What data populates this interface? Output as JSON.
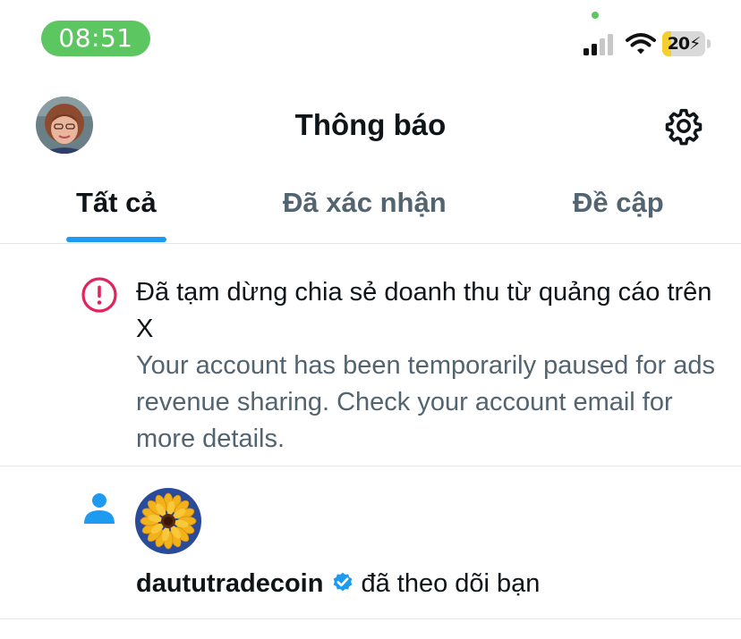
{
  "status_bar": {
    "time": "08:51",
    "battery": "20",
    "battery_level": 0.2,
    "charging": true,
    "signal_icon": "cellular-signal-icon",
    "wifi_icon": "wifi-icon"
  },
  "header": {
    "title": "Thông báo",
    "settings_icon": "gear-icon"
  },
  "tabs": [
    {
      "label": "Tất cả",
      "active": true
    },
    {
      "label": "Đã xác nhận",
      "active": false
    },
    {
      "label": "Đề cập",
      "active": false
    }
  ],
  "notifications": [
    {
      "icon": "alert-circle-icon",
      "title": "Đã tạm dừng chia sẻ doanh thu từ quảng cáo trên X",
      "body": "Your account has been temporarily paused for ads revenue sharing. Check your account email for more details."
    },
    {
      "icon": "person-icon",
      "username": "daututradecoin",
      "verified": true,
      "action": "đã theo dõi bạn"
    }
  ],
  "colors": {
    "accent": "#1d9bf0",
    "alert": "#e0245e",
    "time_pill": "#5cc660",
    "secondary_text": "#536471"
  }
}
